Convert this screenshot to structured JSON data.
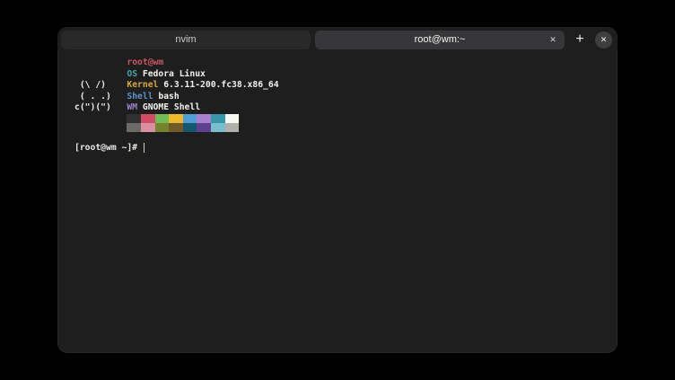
{
  "window": {
    "header": {
      "tabs": [
        {
          "label": "nvim",
          "active": false
        },
        {
          "label": "root@wm:~",
          "active": true
        }
      ],
      "tab_close_glyph": "✕",
      "new_tab_glyph": "+",
      "window_close_glyph": "✕"
    }
  },
  "terminal": {
    "colors": {
      "background": "#1e1e1f",
      "foreground": "#f0f0ec",
      "title": "#c9585e",
      "os_label": "#46a5a3",
      "kernel_label": "#d7a53f",
      "shell_label": "#5c92c9",
      "wm_label": "#9e83c6"
    },
    "fetch": {
      "art": [
        "",
        "",
        " (\\ /)",
        " ( . .)",
        "c(\")(\")"
      ],
      "title": "root@wm",
      "entries": [
        {
          "label": "OS",
          "value": "Fedora Linux"
        },
        {
          "label": "Kernel",
          "value": "6.3.11-200.fc38.x86_64"
        },
        {
          "label": "Shell",
          "value": "bash"
        },
        {
          "label": "WM",
          "value": "GNOME Shell"
        }
      ],
      "palette_row1": [
        "#2f3130",
        "#d24a63",
        "#72bb55",
        "#eeb82f",
        "#4d9fd4",
        "#aa80cc",
        "#3697a9",
        "#f8f8f3"
      ],
      "palette_row2": [
        "#6c6a66",
        "#d98fa2",
        "#75842c",
        "#715928",
        "#14556f",
        "#5d4090",
        "#78bfce",
        "#b0afa9"
      ]
    },
    "prompt": "[root@wm ~]# "
  }
}
